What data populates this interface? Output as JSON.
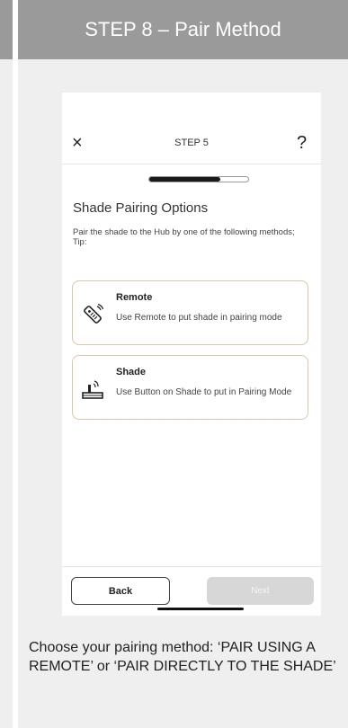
{
  "header": {
    "title": "STEP 8 – Pair Method"
  },
  "phone": {
    "step_label": "STEP 5",
    "close_glyph": "×",
    "help_glyph": "?",
    "progress": 0.72,
    "title": "Shade Pairing Options",
    "description": "Pair the shade to the Hub by one of the following methods;",
    "tip": "Tip:",
    "options": [
      {
        "title": "Remote",
        "description": "Use Remote to put shade in pairing mode",
        "icon": "remote-icon"
      },
      {
        "title": "Shade",
        "description": "Use Button on Shade to put in Pairing Mode",
        "icon": "shade-button-icon"
      }
    ],
    "back_label": "Back",
    "next_label": "Next"
  },
  "caption": "Choose your pairing method: ‘PAIR USING A REMOTE’ or ‘PAIR DIRECTLY TO THE SHADE’",
  "colors": {
    "header_bg": "#9a9a9a",
    "panel_bg": "#efefef",
    "card_border": "#d6c9a8",
    "next_disabled": "#d7d7d7"
  }
}
